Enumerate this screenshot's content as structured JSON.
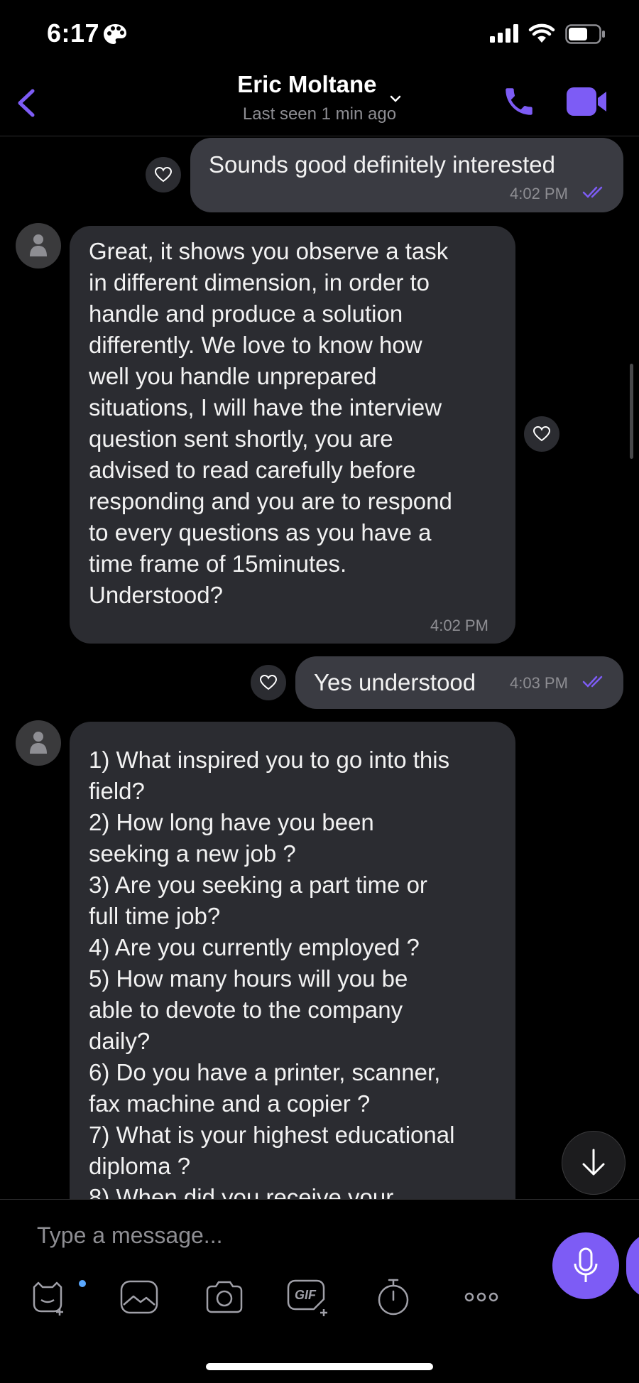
{
  "status_bar": {
    "time": "6:17"
  },
  "header": {
    "back_icon": "chevron-left-icon",
    "contact_name": "Eric Moltane",
    "last_seen": "Last seen 1 min ago",
    "accent_color": "#7d5cf5"
  },
  "messages": [
    {
      "direction": "outgoing",
      "text": "Sounds good definitely interested",
      "time": "4:02 PM",
      "status": "read"
    },
    {
      "direction": "incoming",
      "text": "Great, it shows you observe a task\nin different dimension, in order to\nhandle and produce a solution\ndifferently. We love to know how\nwell you handle unprepared\nsituations, I will have the interview\nquestion sent shortly, you are\nadvised to read carefully before\nresponding and you are to respond\nto every questions as you have a\ntime frame of 15minutes.\nUnderstood?",
      "time": "4:02 PM"
    },
    {
      "direction": "outgoing",
      "text": "Yes understood",
      "time": "4:03 PM",
      "status": "read"
    },
    {
      "direction": "incoming",
      "text": "1) What inspired you to go into this\nfield?\n2) How long have you been\nseeking a new job ?\n3) Are you seeking a part time or\nfull time job?\n4) Are you currently employed ?\n5) How many hours will you be\nable to devote to the company\ndaily?\n6) Do you have a printer, scanner,\nfax machine and a copier ?\n7) What is your highest educational\ndiploma ?\n8) When did you receive your"
    }
  ],
  "composer": {
    "placeholder": "Type a message...",
    "tools": [
      "sticker-icon",
      "gallery-icon",
      "camera-icon",
      "gif-icon",
      "timer-icon",
      "more-icon"
    ],
    "gif_label": "GIF",
    "mic_color": "#7d5cf5"
  }
}
